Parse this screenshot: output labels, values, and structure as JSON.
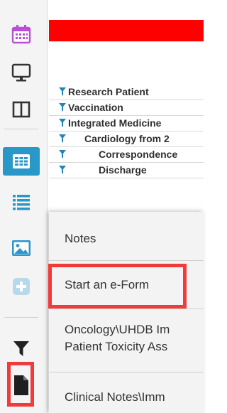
{
  "tree": {
    "rows": [
      {
        "label": "Research Patient"
      },
      {
        "label": "Vaccination"
      },
      {
        "label": "Integrated Medicine"
      },
      {
        "label": "Cardiology from 2"
      },
      {
        "label": "Correspondence"
      },
      {
        "label": "Discharge"
      }
    ]
  },
  "menu": {
    "items": [
      {
        "label": "Notes"
      },
      {
        "label": "Start an e-Form"
      },
      {
        "label_line1": "Oncology\\UHDB Im",
        "label_line2": "Patient Toxicity Ass"
      },
      {
        "label": "Clinical Notes\\Imm"
      }
    ]
  },
  "colors": {
    "accent": "#2a97c9",
    "header_band": "#ff0000",
    "highlight": "#ef3b3b",
    "filter_icon": "#1e86b8",
    "calendar_icon": "#b84fd6"
  }
}
